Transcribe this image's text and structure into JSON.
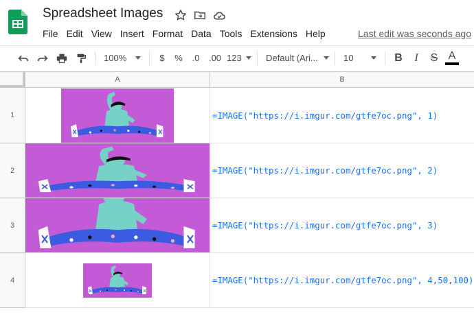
{
  "app": {
    "title": "Spreadsheet Images",
    "last_edit": "Last edit was seconds ago",
    "icons": [
      "star-icon",
      "move-to-folder-icon",
      "cloud-status-icon"
    ]
  },
  "menu": {
    "items": [
      "File",
      "Edit",
      "View",
      "Insert",
      "Format",
      "Data",
      "Tools",
      "Extensions",
      "Help"
    ]
  },
  "toolbar": {
    "zoom": "100%",
    "currency": "$",
    "percent": "%",
    "decrease_decimal": ".0",
    "increase_decimal": ".00",
    "more_formats": "123",
    "font": "Default (Ari...",
    "font_size": "10",
    "bold": "B",
    "italic": "I",
    "strike": "S",
    "text_color": "A",
    "text_color_value": "#000000"
  },
  "sheet": {
    "columns": [
      "A",
      "B"
    ],
    "rows": [
      {
        "number": "1",
        "formula": "=IMAGE(\"https://i.imgur.com/gtfe7oc.png\", 1)"
      },
      {
        "number": "2",
        "formula": "=IMAGE(\"https://i.imgur.com/gtfe7oc.png\", 2)"
      },
      {
        "number": "3",
        "formula": "=IMAGE(\"https://i.imgur.com/gtfe7oc.png\", 3)"
      },
      {
        "number": "4",
        "formula": "=IMAGE(\"https://i.imgur.com/gtfe7oc.png\", 4,50,100)"
      }
    ]
  },
  "colors": {
    "image_background": "#c35bd7",
    "formula_text": "#1a73e8",
    "logo_green": "#0f9d58"
  }
}
